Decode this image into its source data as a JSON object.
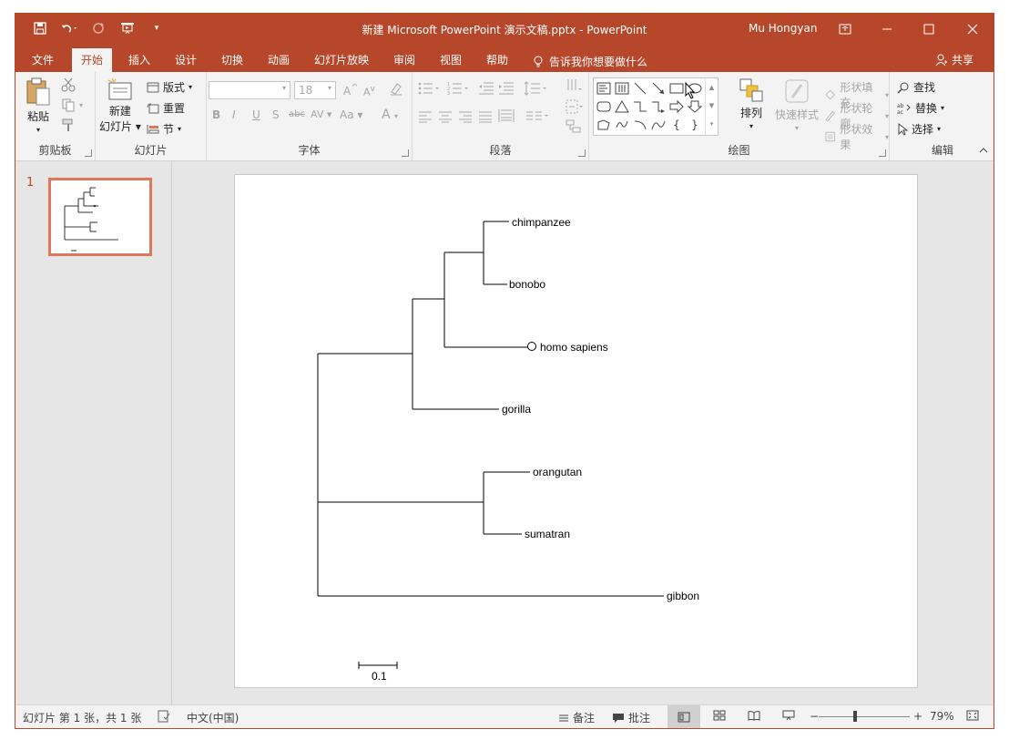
{
  "window": {
    "title": "新建 Microsoft PowerPoint 演示文稿.pptx  -  PowerPoint",
    "user": "Mu Hongyan",
    "accent": "#b7472a"
  },
  "qat": {
    "save_icon": "save-icon",
    "undo_icon": "undo-icon",
    "redo_icon": "redo-icon",
    "present_icon": "present-from-start-icon"
  },
  "tabs": [
    {
      "label": "文件"
    },
    {
      "label": "开始"
    },
    {
      "label": "插入"
    },
    {
      "label": "设计"
    },
    {
      "label": "切换"
    },
    {
      "label": "动画"
    },
    {
      "label": "幻灯片放映"
    },
    {
      "label": "审阅"
    },
    {
      "label": "视图"
    },
    {
      "label": "帮助"
    }
  ],
  "tell_me": "告诉我你想要做什么",
  "share": "共享",
  "ribbon": {
    "clipboard": {
      "paste": "粘贴",
      "label": "剪贴板"
    },
    "slides": {
      "new_slide_1": "新建",
      "new_slide_2": "幻灯片",
      "layout": "版式",
      "reset": "重置",
      "section": "节",
      "label": "幻灯片"
    },
    "font": {
      "font_size": "18",
      "bold": "B",
      "italic": "I",
      "underline": "U",
      "shadow": "S",
      "strike": "abc",
      "spacing": "AV",
      "case": "Aa",
      "color": "A",
      "label": "字体"
    },
    "paragraph": {
      "label": "段落"
    },
    "drawing": {
      "arrange": "排列",
      "quick_styles": "快速样式",
      "shape_fill": "形状填充",
      "shape_outline": "形状轮廓",
      "shape_effects": "形状效果",
      "label": "绘图"
    },
    "editing": {
      "find": "查找",
      "replace": "替换",
      "select": "选择",
      "label": "编辑"
    }
  },
  "thumbnails": {
    "slide_number": "1"
  },
  "slide": {
    "tree": {
      "leaves": [
        "chimpanzee",
        "bonobo",
        "homo sapiens",
        "gorilla",
        "orangutan",
        "sumatran",
        "gibbon"
      ],
      "scale_label": "0.1"
    }
  },
  "status": {
    "slide_info": "幻灯片 第 1 张，共 1 张",
    "language": "中文(中国)",
    "notes": "备注",
    "comments": "批注",
    "zoom": "79%"
  }
}
